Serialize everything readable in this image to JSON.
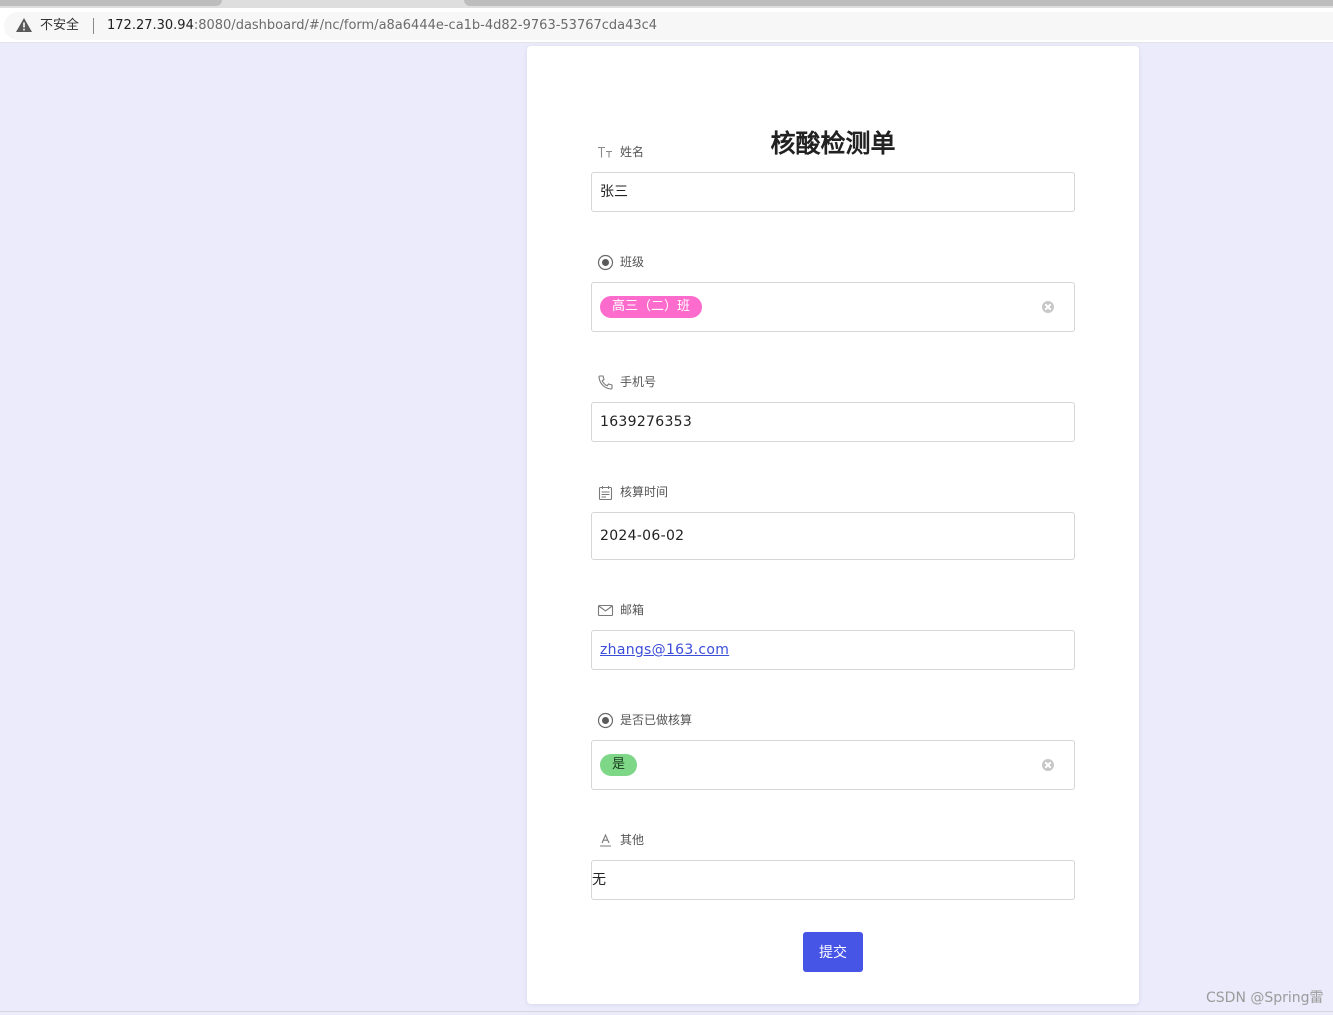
{
  "browser": {
    "security_label": "不安全",
    "url_host": "172.27.30.94",
    "url_rest": ":8080/dashboard/#/nc/form/a8a6444e-ca1b-4d82-9763-53767cda43c4"
  },
  "form": {
    "title": "核酸检测单",
    "fields": [
      {
        "label": "姓名",
        "icon": "text-type-icon",
        "value": "张三"
      },
      {
        "label": "班级",
        "icon": "radio-select-icon",
        "tag": "高三（二）班",
        "tag_color": "#fd6ccc"
      },
      {
        "label": "手机号",
        "icon": "phone-icon",
        "value": "1639276353"
      },
      {
        "label": "核算时间",
        "icon": "calendar-icon",
        "value": "2024-06-02"
      },
      {
        "label": "邮箱",
        "icon": "mail-icon",
        "value": "zhangs@163.com"
      },
      {
        "label": "是否已做核算",
        "icon": "radio-select-icon",
        "tag": "是",
        "tag_color": "#7ed687"
      },
      {
        "label": "其他",
        "icon": "long-text-icon",
        "value": "无"
      }
    ],
    "submit_label": "提交"
  },
  "watermark": "CSDN @Spring雷",
  "colors": {
    "page_background": "#ebebfb",
    "accent": "#4655e6",
    "link": "#3c4dd9"
  }
}
